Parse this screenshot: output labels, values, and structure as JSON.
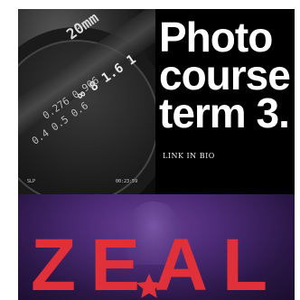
{
  "lens": {
    "focal": "20mm",
    "scale_a": "∞ 8 1.6 1",
    "scale_b": "0.276 0.906",
    "scale_c": "0.4 0.5 0.6"
  },
  "camera_overlay": {
    "mode": "SLP",
    "timecode": "00:23:59"
  },
  "headline": {
    "line1": "Photo",
    "line2": "course",
    "line3": "term 3."
  },
  "cta": "LINK IN BIO",
  "banner": {
    "word": "ZEAL",
    "accent_color": "#e0303a"
  },
  "colors": {
    "background": "#000000",
    "text": "#ffffff",
    "purple": "#4a2a73"
  }
}
